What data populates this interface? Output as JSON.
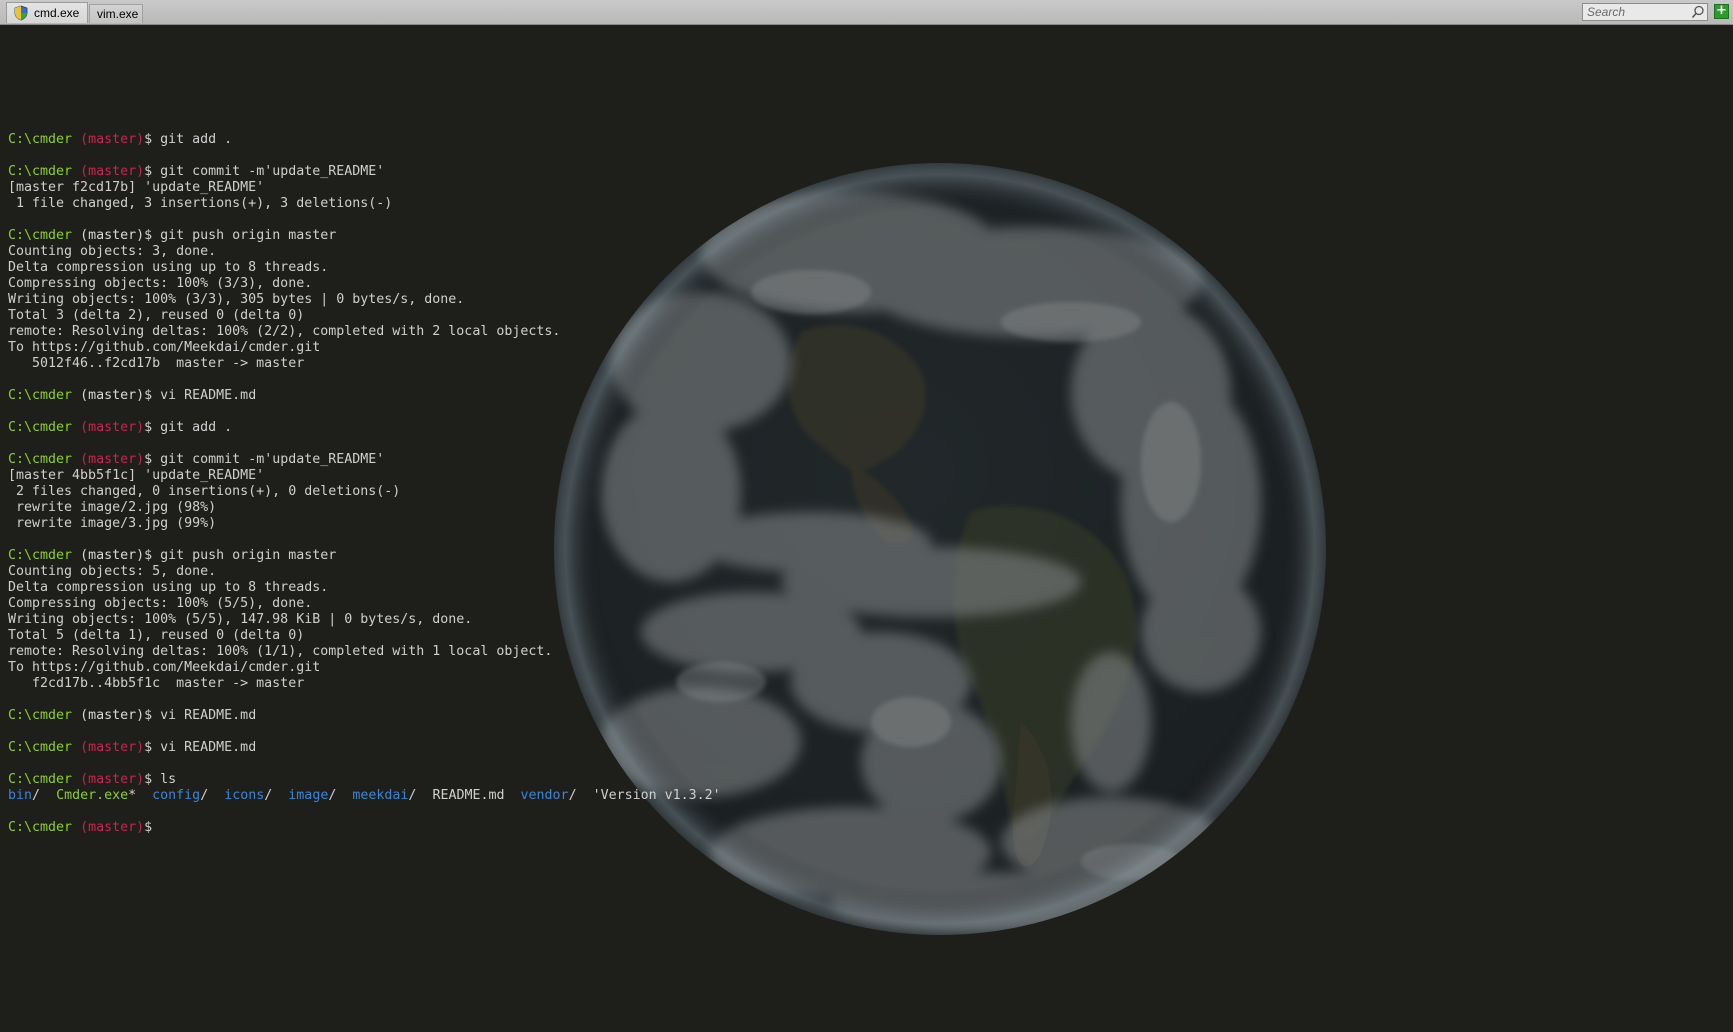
{
  "tabs": [
    {
      "label": "cmd.exe",
      "icon": "shield-icon",
      "active": true
    },
    {
      "label": "vim.exe",
      "active": false
    }
  ],
  "search": {
    "placeholder": "Search"
  },
  "new_tab_button": {
    "label": "+"
  },
  "colors": {
    "background": "#1e1f1b",
    "prompt_path": "#8ccf2b",
    "prompt_branch": "#c7254e",
    "directory": "#3a85d6",
    "executable": "#8ccf2b",
    "text": "#cfcfcf"
  },
  "background_image": "earth-globe",
  "terminal": {
    "prompt_path": "C:\\cmder",
    "branch": "(master)",
    "dollar": "$",
    "lines": [
      {
        "type": "prompt",
        "cmd": " git add ."
      },
      {
        "type": "blank"
      },
      {
        "type": "prompt",
        "cmd": " git commit -m'update_README'"
      },
      {
        "type": "out",
        "text": "[master f2cd17b] 'update_README'"
      },
      {
        "type": "out",
        "text": " 1 file changed, 3 insertions(+), 3 deletions(-)"
      },
      {
        "type": "blank"
      },
      {
        "type": "prompt",
        "cmd": " git push origin master"
      },
      {
        "type": "out",
        "text": "Counting objects: 3, done."
      },
      {
        "type": "out",
        "text": "Delta compression using up to 8 threads."
      },
      {
        "type": "out",
        "text": "Compressing objects: 100% (3/3), done."
      },
      {
        "type": "out",
        "text": "Writing objects: 100% (3/3), 305 bytes | 0 bytes/s, done."
      },
      {
        "type": "out",
        "text": "Total 3 (delta 2), reused 0 (delta 0)"
      },
      {
        "type": "out",
        "text": "remote: Resolving deltas: 100% (2/2), completed with 2 local objects."
      },
      {
        "type": "out",
        "text": "To https://github.com/Meekdai/cmder.git"
      },
      {
        "type": "out",
        "text": "   5012f46..f2cd17b  master -> master"
      },
      {
        "type": "blank"
      },
      {
        "type": "prompt",
        "cmd": " vi README.md"
      },
      {
        "type": "blank"
      },
      {
        "type": "prompt",
        "cmd": " git add ."
      },
      {
        "type": "blank"
      },
      {
        "type": "prompt",
        "cmd": " git commit -m'update_README'"
      },
      {
        "type": "out",
        "text": "[master 4bb5f1c] 'update_README'"
      },
      {
        "type": "out",
        "text": " 2 files changed, 0 insertions(+), 0 deletions(-)"
      },
      {
        "type": "out",
        "text": " rewrite image/2.jpg (98%)"
      },
      {
        "type": "out",
        "text": " rewrite image/3.jpg (99%)"
      },
      {
        "type": "blank"
      },
      {
        "type": "prompt",
        "cmd": " git push origin master"
      },
      {
        "type": "out",
        "text": "Counting objects: 5, done."
      },
      {
        "type": "out",
        "text": "Delta compression using up to 8 threads."
      },
      {
        "type": "out",
        "text": "Compressing objects: 100% (5/5), done."
      },
      {
        "type": "out",
        "text": "Writing objects: 100% (5/5), 147.98 KiB | 0 bytes/s, done."
      },
      {
        "type": "out",
        "text": "Total 5 (delta 1), reused 0 (delta 0)"
      },
      {
        "type": "out",
        "text": "remote: Resolving deltas: 100% (1/1), completed with 1 local object."
      },
      {
        "type": "out",
        "text": "To https://github.com/Meekdai/cmder.git"
      },
      {
        "type": "out",
        "text": "   f2cd17b..4bb5f1c  master -> master"
      },
      {
        "type": "blank"
      },
      {
        "type": "prompt",
        "cmd": " vi README.md"
      },
      {
        "type": "blank"
      },
      {
        "type": "prompt",
        "cmd": " vi README.md"
      },
      {
        "type": "blank"
      },
      {
        "type": "prompt",
        "cmd": " ls"
      },
      {
        "type": "ls",
        "items": [
          {
            "name": "bin",
            "suffix": "/  ",
            "kind": "dir"
          },
          {
            "name": "Cmder.exe",
            "suffix": "*  ",
            "kind": "exe"
          },
          {
            "name": "config",
            "suffix": "/  ",
            "kind": "dir"
          },
          {
            "name": "icons",
            "suffix": "/  ",
            "kind": "dir"
          },
          {
            "name": "image",
            "suffix": "/  ",
            "kind": "dir"
          },
          {
            "name": "meekdai",
            "suffix": "/  ",
            "kind": "dir"
          },
          {
            "name": "README.md",
            "suffix": "  ",
            "kind": "file"
          },
          {
            "name": "vendor",
            "suffix": "/  ",
            "kind": "dir"
          },
          {
            "name": "'Version v1.3.2'",
            "suffix": "",
            "kind": "file"
          }
        ]
      },
      {
        "type": "blank"
      },
      {
        "type": "prompt",
        "cmd": ""
      }
    ]
  }
}
